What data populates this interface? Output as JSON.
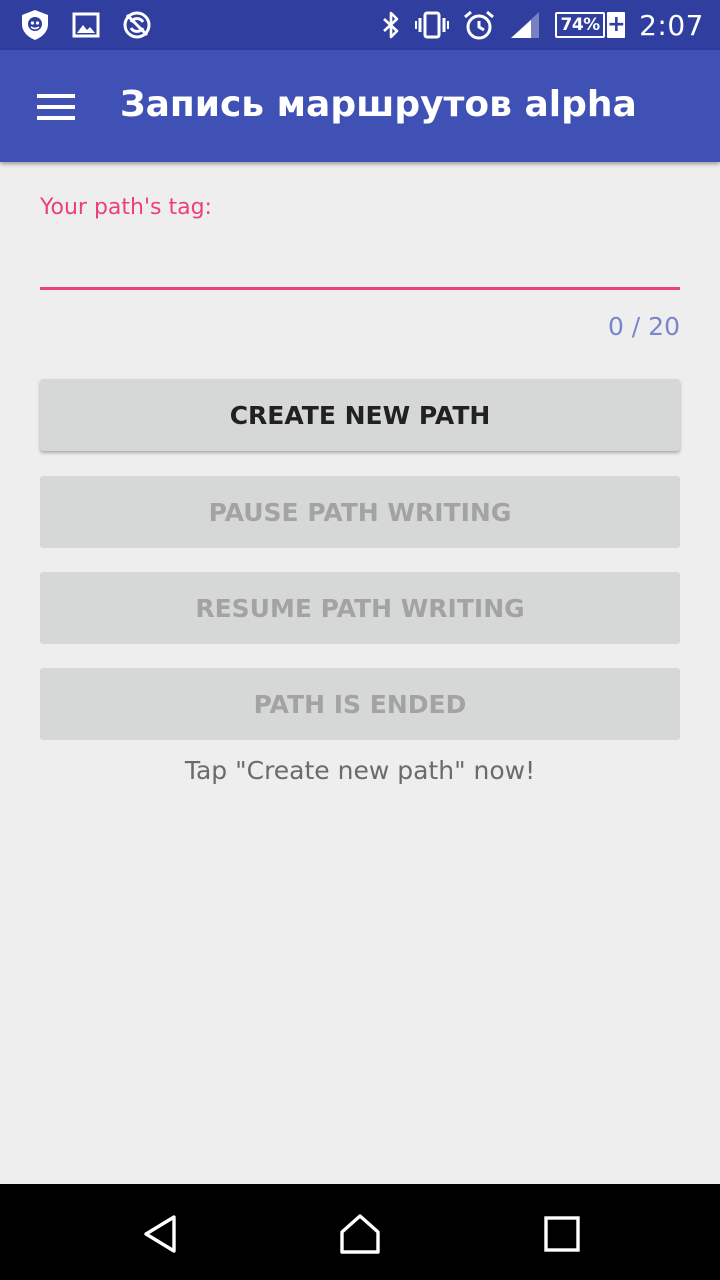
{
  "status_bar": {
    "left_icons": [
      "shield-icon",
      "image-icon",
      "no-sync-icon"
    ],
    "right_icons": [
      "bluetooth-icon",
      "vibrate-icon",
      "alarm-icon",
      "signal-icon",
      "battery-icon"
    ],
    "battery_percent": "74%",
    "battery_level": 0.74,
    "battery_charging": true,
    "time": "2:07",
    "color": "#303f9f"
  },
  "app_bar": {
    "title": "Запись маршрутов alpha",
    "menu_icon": "hamburger-menu-icon",
    "color": "#3f51b5"
  },
  "form": {
    "tag_label": "Your path's tag:",
    "tag_value": "",
    "counter": "0 / 20",
    "accent_color": "#ec407a"
  },
  "buttons": {
    "create": "CREATE NEW PATH",
    "pause": "PAUSE PATH WRITING",
    "resume": "RESUME PATH WRITING",
    "ended": "PATH IS ENDED"
  },
  "hint": "Tap \"Create new path\" now!",
  "nav_bar": {
    "icons": [
      "back-icon",
      "home-icon",
      "recents-icon"
    ]
  }
}
